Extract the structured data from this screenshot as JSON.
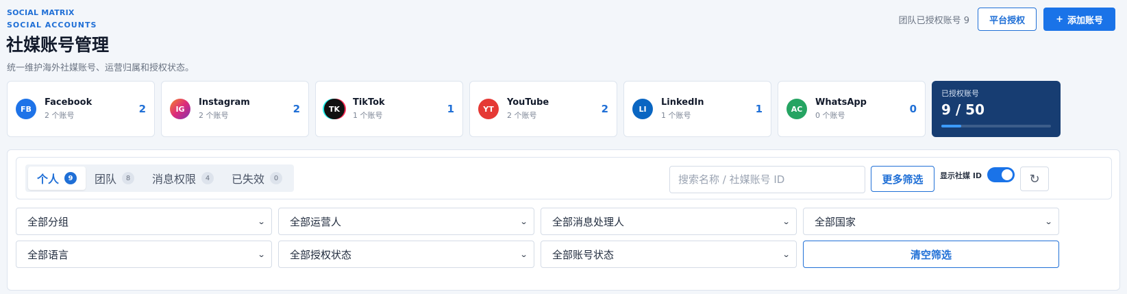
{
  "header": {
    "brand_line1": "SOCIAL MATRIX",
    "brand_line2": "SOCIAL ACCOUNTS",
    "title": "社媒账号管理",
    "subtitle": "统一维护海外社媒账号、运营归属和授权状态。",
    "team_authorized": "团队已授权账号 9",
    "platform_auth_label": "平台授权",
    "add_account_label": "添加账号",
    "add_account_icon": "plus-icon"
  },
  "platforms": [
    {
      "abbr": "FB",
      "name": "Facebook",
      "sub": "2 个账号",
      "count": "2",
      "color": "#1e73e8"
    },
    {
      "abbr": "IG",
      "name": "Instagram",
      "sub": "2 个账号",
      "count": "2",
      "color": "#c2359a"
    },
    {
      "abbr": "TK",
      "name": "TikTok",
      "sub": "1 个账号",
      "count": "1",
      "color": "#111111"
    },
    {
      "abbr": "YT",
      "name": "YouTube",
      "sub": "2 个账号",
      "count": "2",
      "color": "#e53935"
    },
    {
      "abbr": "LI",
      "name": "LinkedIn",
      "sub": "1 个账号",
      "count": "1",
      "color": "#0a66c2"
    },
    {
      "abbr": "AC",
      "name": "WhatsApp",
      "sub": "0 个账号",
      "count": "0",
      "color": "#25a462"
    }
  ],
  "quota": {
    "label": "已授权账号",
    "value": "9 / 50",
    "progress": 0.18
  },
  "tabs": [
    {
      "label": "个人",
      "count": "9"
    },
    {
      "label": "团队",
      "count": "8"
    },
    {
      "label": "消息权限",
      "count": "4"
    },
    {
      "label": "已失效",
      "count": "0"
    }
  ],
  "search": {
    "placeholder": "搜索名称 / 社媒账号 ID"
  },
  "more_filters_label": "更多筛选",
  "toggle_label": "显示社媒 ID",
  "refresh_icon": "refresh-icon",
  "filters": {
    "group": "全部分组",
    "operator": "全部运营人",
    "message_handler": "全部消息处理人",
    "country": "全部国家",
    "language": "全部语言",
    "auth_status": "全部授权状态",
    "account_status": "全部账号状态",
    "clear_label": "清空筛选"
  },
  "colors": {
    "accent": "#1a73e8",
    "quota_bg": "#173d72"
  }
}
